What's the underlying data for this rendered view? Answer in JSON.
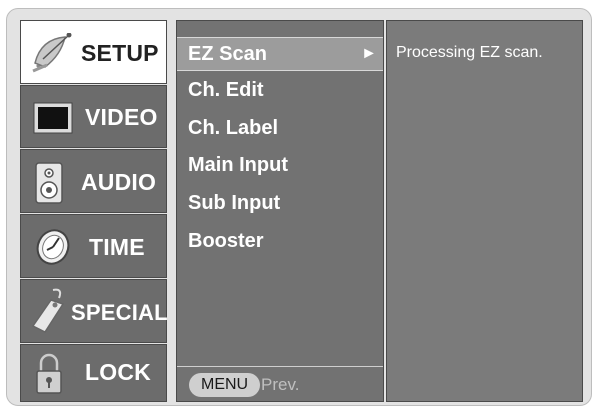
{
  "tabs": [
    {
      "id": "setup",
      "label": "SETUP",
      "icon": "satellite-dish-icon",
      "active": true
    },
    {
      "id": "video",
      "label": "VIDEO",
      "icon": "tv-screen-icon",
      "active": false
    },
    {
      "id": "audio",
      "label": "AUDIO",
      "icon": "speaker-icon",
      "active": false
    },
    {
      "id": "time",
      "label": "TIME",
      "icon": "clock-icon",
      "active": false
    },
    {
      "id": "special",
      "label": "SPECIAL",
      "icon": "tag-icon",
      "active": false
    },
    {
      "id": "lock",
      "label": "LOCK",
      "icon": "padlock-icon",
      "active": false
    }
  ],
  "submenu": {
    "items": [
      {
        "label": "EZ Scan",
        "selected": true,
        "arrow": "►"
      },
      {
        "label": "Ch. Edit",
        "selected": false
      },
      {
        "label": "Ch. Label",
        "selected": false
      },
      {
        "label": "Main Input",
        "selected": false
      },
      {
        "label": "Sub Input",
        "selected": false
      },
      {
        "label": "Booster",
        "selected": false
      }
    ],
    "footer": {
      "menu_button": "MENU",
      "prev_label": "Prev."
    }
  },
  "detail": {
    "message": "Processing EZ scan."
  },
  "colors": {
    "panel": "#727272",
    "selected": "#9c9c9c",
    "active_tab": "#ffffff",
    "frame": "#e3e3e3"
  }
}
